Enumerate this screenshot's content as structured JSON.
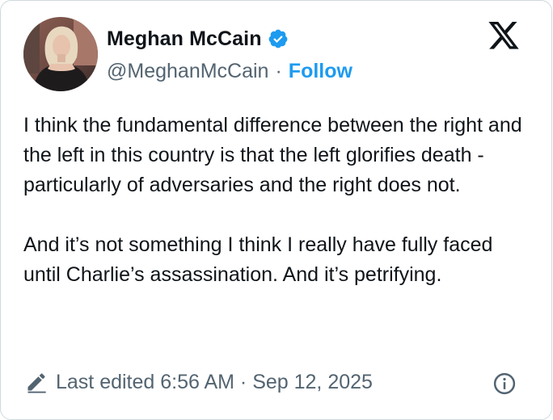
{
  "author": {
    "display_name": "Meghan McCain",
    "handle": "@MeghanMcCain",
    "separator": "·",
    "follow_label": "Follow",
    "verified": true
  },
  "tweet": {
    "text": "I think the fundamental difference between the right and the left in this country is that the left glorifies death - particularly of adversaries and the right does not.\n\nAnd it’s not something I think I really have fully faced until Charlie’s assassination. And it’s petrifying."
  },
  "footer": {
    "edited_label": "Last edited 6:56 AM · Sep 12, 2025"
  },
  "icons": {
    "verified": "verified-badge-icon",
    "brand": "x-logo-icon",
    "edit": "pencil-icon",
    "info": "info-icon"
  },
  "colors": {
    "accent": "#1d9bf0",
    "text_primary": "#0f1419",
    "text_secondary": "#536471",
    "border": "#cfd9de"
  }
}
